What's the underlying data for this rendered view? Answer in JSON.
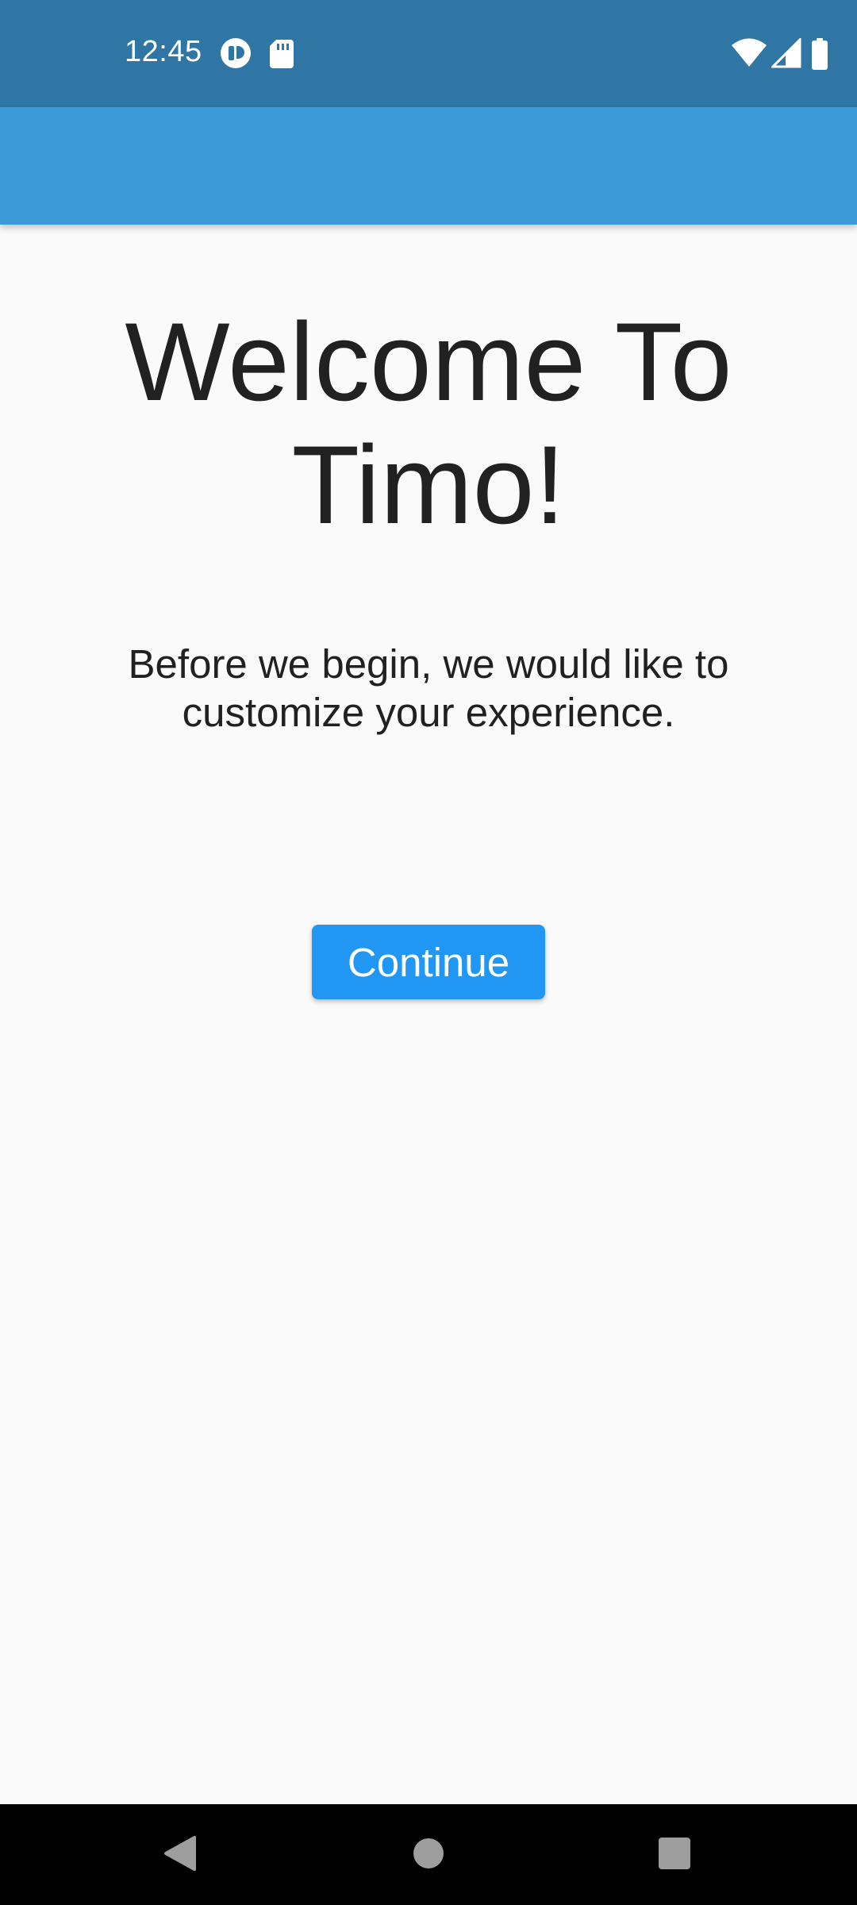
{
  "status_bar": {
    "time": "12:45",
    "left_icons": [
      "app-notification-icon",
      "sd-card-icon"
    ],
    "right_icons": [
      "wifi-icon",
      "cellular-signal-icon",
      "battery-icon"
    ],
    "background_color": "#2f76a4"
  },
  "app_bar": {
    "background_color": "#3d9ad8"
  },
  "main": {
    "title": "Welcome To Timo!",
    "subtitle": "Before we begin, we would like to customize your experience.",
    "continue_label": "Continue",
    "button_color": "#2196f3",
    "background_color": "#fafafa"
  },
  "nav_bar": {
    "buttons": [
      "back-icon",
      "home-icon",
      "recents-icon"
    ]
  }
}
